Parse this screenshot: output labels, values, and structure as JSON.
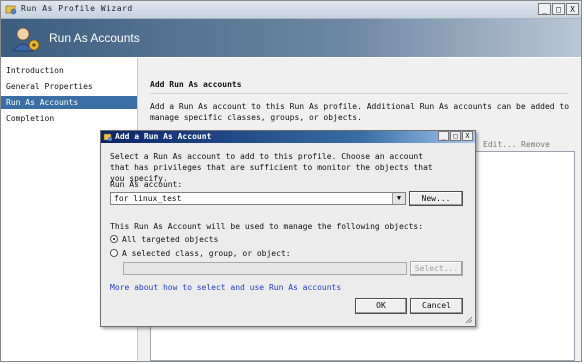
{
  "window": {
    "title": "Run As Profile Wizard",
    "header_title": "Run As Accounts",
    "controls": {
      "minimize": "_",
      "maximize": "□",
      "close": "X"
    }
  },
  "nav": {
    "items": [
      {
        "label": "Introduction",
        "selected": false
      },
      {
        "label": "General Properties",
        "selected": false
      },
      {
        "label": "Run As Accounts",
        "selected": true
      },
      {
        "label": "Completion",
        "selected": false
      }
    ]
  },
  "main": {
    "title": "Add Run As accounts",
    "description": "Add a Run As account to this Run As profile.  Additional Run As accounts can be added to manage specific classes, groups, or objects.",
    "edit_label": "Edit...",
    "remove_label": "Remove"
  },
  "dialog": {
    "title": "Add a Run As Account",
    "controls": {
      "minimize": "_",
      "maximize": "□",
      "close": "X"
    },
    "description": "Select a Run As account to add to this profile.  Choose an account that has privileges that are sufficient to monitor the objects that you specify.",
    "account_label": "Run As account:",
    "account_value": "for  linux_test",
    "new_button": "New...",
    "manage_label": "This Run As Account will be used to manage the following objects:",
    "option_all": "All targeted objects",
    "option_selected": "A selected class, group, or object:",
    "selected_option": "all",
    "object_value": "",
    "select_button": "Select...",
    "help_link": "More about how to select and use Run As accounts",
    "ok_button": "OK",
    "cancel_button": "Cancel"
  },
  "colors": {
    "header_dark": "#3d5d7f",
    "nav_selected": "#3a6ea5",
    "dialog_title": "#0a246a",
    "link": "#1f3fcc"
  }
}
